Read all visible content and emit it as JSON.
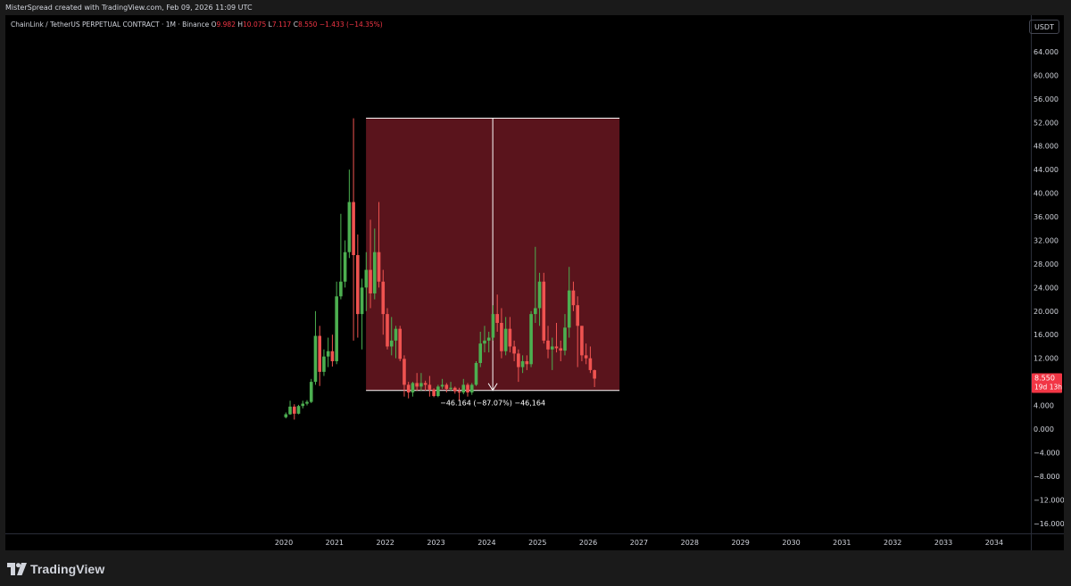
{
  "caption": "MisterSpread created with TradingView.com, Feb 09, 2026 11:09 UTC",
  "legend": {
    "symbol": "ChainLink / TetherUS PERPETUAL CONTRACT · 1M · Binance",
    "o_label": "O",
    "o_value": "9.982",
    "h_label": "H",
    "h_value": "10.075",
    "l_label": "L",
    "l_value": "7.117",
    "c_label": "C",
    "c_value": "8.550",
    "change": "−1.433 (−14.35%)"
  },
  "currency": "USDT",
  "footer": {
    "brand": "TradingView"
  },
  "colors": {
    "up": "#26a69a",
    "up_body": "#4caf50",
    "down": "#f23645",
    "down_body": "#ef5350",
    "measure_fill": "#5a141c",
    "measure_line": "#ffffff"
  },
  "chart_data": {
    "type": "candlestick",
    "title": "ChainLink / TetherUS PERPETUAL CONTRACT · 1M · Binance",
    "ylim": [
      -18,
      68
    ],
    "y_ticks": [
      64,
      60,
      56,
      52,
      48,
      44,
      40,
      36,
      32,
      28,
      24,
      20,
      16,
      12,
      4,
      0,
      -4,
      -8,
      -12,
      -16
    ],
    "y_tick_labels": [
      "64.000",
      "60.000",
      "56.000",
      "52.000",
      "48.000",
      "44.000",
      "40.000",
      "36.000",
      "32.000",
      "28.000",
      "24.000",
      "20.000",
      "16.000",
      "12.000",
      "4.000",
      "0.000",
      "−4.000",
      "−8.000",
      "−12.000",
      "−16.000"
    ],
    "x_ticks": [
      "2020",
      "2021",
      "2022",
      "2023",
      "2024",
      "2025",
      "2026",
      "2027",
      "2028",
      "2029",
      "2030",
      "2031",
      "2032",
      "2033",
      "2034"
    ],
    "x_start_year": 2020,
    "last_price": {
      "value": 8.55,
      "label": "8.550",
      "countdown": "19d 13h"
    },
    "measure": {
      "from_date": "2021-05",
      "to_date": "2026-02",
      "top": 52.714,
      "bottom": 6.55,
      "label": "−46.164 (−87.07%) −46,164"
    },
    "candles": [
      {
        "d": "2020-01",
        "o": 2.0,
        "h": 2.8,
        "l": 1.8,
        "c": 2.5
      },
      {
        "d": "2020-02",
        "o": 2.5,
        "h": 4.8,
        "l": 2.4,
        "c": 3.8
      },
      {
        "d": "2020-03",
        "o": 3.8,
        "h": 4.2,
        "l": 1.6,
        "c": 2.6
      },
      {
        "d": "2020-04",
        "o": 2.6,
        "h": 4.1,
        "l": 2.5,
        "c": 3.9
      },
      {
        "d": "2020-05",
        "o": 3.9,
        "h": 4.8,
        "l": 3.5,
        "c": 4.3
      },
      {
        "d": "2020-06",
        "o": 4.3,
        "h": 4.9,
        "l": 4.0,
        "c": 4.6
      },
      {
        "d": "2020-07",
        "o": 4.6,
        "h": 8.5,
        "l": 4.4,
        "c": 8.0
      },
      {
        "d": "2020-08",
        "o": 8.0,
        "h": 20.0,
        "l": 7.5,
        "c": 15.8
      },
      {
        "d": "2020-09",
        "o": 15.8,
        "h": 17.5,
        "l": 7.3,
        "c": 9.7
      },
      {
        "d": "2020-10",
        "o": 9.7,
        "h": 13.5,
        "l": 9.0,
        "c": 12.3
      },
      {
        "d": "2020-11",
        "o": 12.3,
        "h": 15.5,
        "l": 10.5,
        "c": 13.2
      },
      {
        "d": "2020-12",
        "o": 13.2,
        "h": 16.0,
        "l": 10.6,
        "c": 11.5
      },
      {
        "d": "2021-01",
        "o": 11.5,
        "h": 25.0,
        "l": 11.0,
        "c": 22.5
      },
      {
        "d": "2021-02",
        "o": 22.5,
        "h": 36.5,
        "l": 22.0,
        "c": 25.0
      },
      {
        "d": "2021-03",
        "o": 25.0,
        "h": 32.0,
        "l": 24.0,
        "c": 30.0
      },
      {
        "d": "2021-04",
        "o": 30.0,
        "h": 44.0,
        "l": 29.0,
        "c": 38.5
      },
      {
        "d": "2021-05",
        "o": 38.5,
        "h": 52.7,
        "l": 15.0,
        "c": 29.5
      },
      {
        "d": "2021-06",
        "o": 29.5,
        "h": 33.0,
        "l": 15.5,
        "c": 19.5
      },
      {
        "d": "2021-07",
        "o": 19.5,
        "h": 25.5,
        "l": 13.5,
        "c": 24.0
      },
      {
        "d": "2021-08",
        "o": 24.0,
        "h": 30.0,
        "l": 20.0,
        "c": 27.0
      },
      {
        "d": "2021-09",
        "o": 27.0,
        "h": 35.5,
        "l": 20.5,
        "c": 23.0
      },
      {
        "d": "2021-10",
        "o": 23.0,
        "h": 34.0,
        "l": 22.0,
        "c": 30.0
      },
      {
        "d": "2021-11",
        "o": 30.0,
        "h": 38.5,
        "l": 24.0,
        "c": 25.0
      },
      {
        "d": "2021-12",
        "o": 25.0,
        "h": 27.0,
        "l": 16.0,
        "c": 19.5
      },
      {
        "d": "2022-01",
        "o": 19.5,
        "h": 20.5,
        "l": 13.5,
        "c": 14.0
      },
      {
        "d": "2022-02",
        "o": 14.0,
        "h": 19.0,
        "l": 12.5,
        "c": 15.0
      },
      {
        "d": "2022-03",
        "o": 15.0,
        "h": 17.5,
        "l": 12.0,
        "c": 17.0
      },
      {
        "d": "2022-04",
        "o": 17.0,
        "h": 17.5,
        "l": 11.5,
        "c": 11.9
      },
      {
        "d": "2022-05",
        "o": 11.9,
        "h": 12.5,
        "l": 5.5,
        "c": 7.5
      },
      {
        "d": "2022-06",
        "o": 7.5,
        "h": 8.0,
        "l": 5.2,
        "c": 6.2
      },
      {
        "d": "2022-07",
        "o": 6.2,
        "h": 8.0,
        "l": 5.5,
        "c": 7.8
      },
      {
        "d": "2022-08",
        "o": 7.8,
        "h": 9.5,
        "l": 6.5,
        "c": 7.2
      },
      {
        "d": "2022-09",
        "o": 7.2,
        "h": 9.5,
        "l": 6.5,
        "c": 7.8
      },
      {
        "d": "2022-10",
        "o": 7.8,
        "h": 8.2,
        "l": 6.5,
        "c": 7.5
      },
      {
        "d": "2022-11",
        "o": 7.5,
        "h": 9.0,
        "l": 5.5,
        "c": 6.7
      },
      {
        "d": "2022-12",
        "o": 6.7,
        "h": 6.9,
        "l": 5.4,
        "c": 5.6
      },
      {
        "d": "2023-01",
        "o": 5.6,
        "h": 7.5,
        "l": 5.4,
        "c": 7.2
      },
      {
        "d": "2023-02",
        "o": 7.2,
        "h": 8.5,
        "l": 6.8,
        "c": 7.5
      },
      {
        "d": "2023-03",
        "o": 7.5,
        "h": 7.8,
        "l": 6.2,
        "c": 6.8
      },
      {
        "d": "2023-04",
        "o": 6.8,
        "h": 8.0,
        "l": 6.5,
        "c": 7.0
      },
      {
        "d": "2023-05",
        "o": 7.0,
        "h": 7.2,
        "l": 6.0,
        "c": 6.4
      },
      {
        "d": "2023-06",
        "o": 6.4,
        "h": 7.0,
        "l": 4.8,
        "c": 6.2
      },
      {
        "d": "2023-07",
        "o": 6.2,
        "h": 8.5,
        "l": 5.9,
        "c": 7.5
      },
      {
        "d": "2023-08",
        "o": 7.5,
        "h": 7.8,
        "l": 5.5,
        "c": 6.2
      },
      {
        "d": "2023-09",
        "o": 6.2,
        "h": 7.8,
        "l": 5.8,
        "c": 7.5
      },
      {
        "d": "2023-10",
        "o": 7.5,
        "h": 11.5,
        "l": 7.3,
        "c": 11.2
      },
      {
        "d": "2023-11",
        "o": 11.2,
        "h": 16.5,
        "l": 10.5,
        "c": 14.5
      },
      {
        "d": "2023-12",
        "o": 14.5,
        "h": 17.5,
        "l": 13.0,
        "c": 15.0
      },
      {
        "d": "2024-01",
        "o": 15.0,
        "h": 16.5,
        "l": 13.0,
        "c": 15.5
      },
      {
        "d": "2024-02",
        "o": 15.5,
        "h": 21.0,
        "l": 15.0,
        "c": 19.5
      },
      {
        "d": "2024-03",
        "o": 19.5,
        "h": 22.8,
        "l": 16.5,
        "c": 18.0
      },
      {
        "d": "2024-04",
        "o": 18.0,
        "h": 20.5,
        "l": 12.0,
        "c": 13.2
      },
      {
        "d": "2024-05",
        "o": 13.2,
        "h": 19.0,
        "l": 12.5,
        "c": 17.0
      },
      {
        "d": "2024-06",
        "o": 17.0,
        "h": 19.0,
        "l": 13.0,
        "c": 14.0
      },
      {
        "d": "2024-07",
        "o": 14.0,
        "h": 15.0,
        "l": 11.5,
        "c": 12.8
      },
      {
        "d": "2024-08",
        "o": 12.8,
        "h": 13.5,
        "l": 8.0,
        "c": 10.5
      },
      {
        "d": "2024-09",
        "o": 10.5,
        "h": 12.5,
        "l": 9.5,
        "c": 11.5
      },
      {
        "d": "2024-10",
        "o": 11.5,
        "h": 12.5,
        "l": 10.0,
        "c": 11.0
      },
      {
        "d": "2024-11",
        "o": 11.0,
        "h": 20.0,
        "l": 10.5,
        "c": 19.5
      },
      {
        "d": "2024-12",
        "o": 19.5,
        "h": 30.9,
        "l": 18.0,
        "c": 20.5
      },
      {
        "d": "2025-01",
        "o": 20.5,
        "h": 26.5,
        "l": 17.5,
        "c": 25.0
      },
      {
        "d": "2025-02",
        "o": 25.0,
        "h": 26.5,
        "l": 14.5,
        "c": 15.0
      },
      {
        "d": "2025-03",
        "o": 15.0,
        "h": 17.5,
        "l": 12.0,
        "c": 13.5
      },
      {
        "d": "2025-04",
        "o": 13.5,
        "h": 15.5,
        "l": 10.0,
        "c": 14.0
      },
      {
        "d": "2025-05",
        "o": 14.0,
        "h": 18.0,
        "l": 13.0,
        "c": 13.7
      },
      {
        "d": "2025-06",
        "o": 13.7,
        "h": 15.0,
        "l": 11.5,
        "c": 13.3
      },
      {
        "d": "2025-07",
        "o": 13.3,
        "h": 19.5,
        "l": 12.5,
        "c": 17.2
      },
      {
        "d": "2025-08",
        "o": 17.2,
        "h": 27.5,
        "l": 15.5,
        "c": 23.5
      },
      {
        "d": "2025-09",
        "o": 23.5,
        "h": 25.0,
        "l": 20.0,
        "c": 21.0
      },
      {
        "d": "2025-10",
        "o": 21.0,
        "h": 22.5,
        "l": 10.5,
        "c": 17.5
      },
      {
        "d": "2025-11",
        "o": 17.5,
        "h": 17.5,
        "l": 11.5,
        "c": 12.5
      },
      {
        "d": "2025-12",
        "o": 12.5,
        "h": 14.5,
        "l": 11.0,
        "c": 12.0
      },
      {
        "d": "2026-01",
        "o": 12.0,
        "h": 14.0,
        "l": 9.5,
        "c": 10.0
      },
      {
        "d": "2026-02",
        "o": 9.982,
        "h": 10.075,
        "l": 7.117,
        "c": 8.55
      }
    ]
  }
}
